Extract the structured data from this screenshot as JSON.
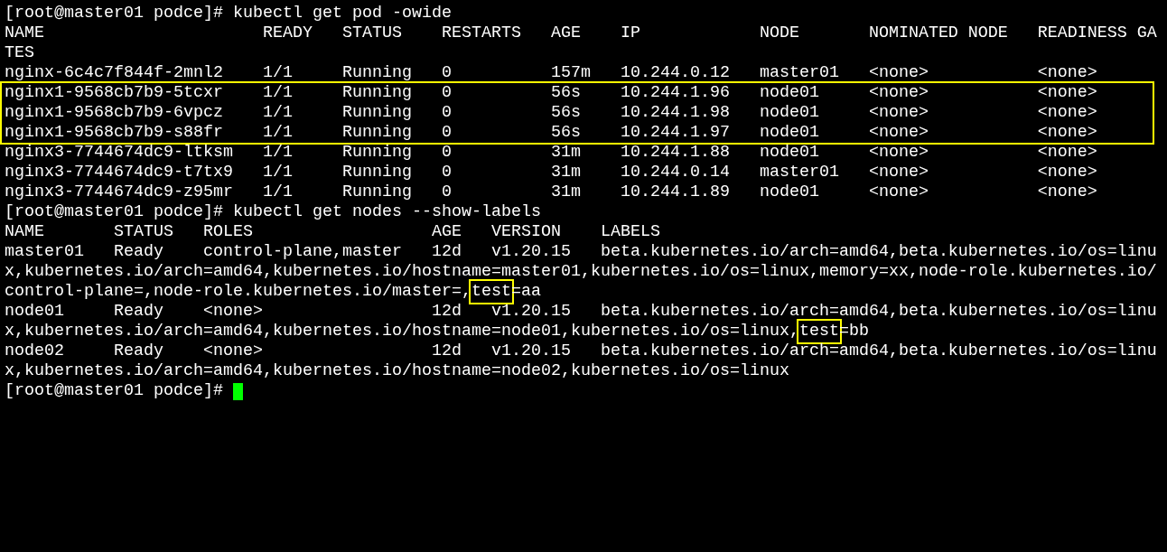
{
  "terminal": {
    "blocks": [
      {
        "kind": "line",
        "text": "[root@master01 podce]# kubectl get pod -owide"
      },
      {
        "kind": "line",
        "text": "NAME                      READY   STATUS    RESTARTS   AGE    IP            NODE       NOMINATED NODE   READINESS GA"
      },
      {
        "kind": "line",
        "text": "TES"
      },
      {
        "kind": "line",
        "text": "nginx-6c4c7f844f-2mnl2    1/1     Running   0          157m   10.244.0.12   master01   <none>           <none>"
      },
      {
        "kind": "group",
        "highlighted": true,
        "lines": [
          {
            "text": "nginx1-9568cb7b9-5tcxr    1/1     Running   0          56s    10.244.1.96   node01     <none>           <none>"
          },
          {
            "text": "nginx1-9568cb7b9-6vpcz    1/1     Running   0          56s    10.244.1.98   node01     <none>           <none>"
          },
          {
            "text": "nginx1-9568cb7b9-s88fr    1/1     Running   0          56s    10.244.1.97   node01     <none>           <none>"
          }
        ]
      },
      {
        "kind": "line",
        "text": "nginx3-7744674dc9-ltksm   1/1     Running   0          31m    10.244.1.88   node01     <none>           <none>"
      },
      {
        "kind": "line",
        "text": "nginx3-7744674dc9-t7tx9   1/1     Running   0          31m    10.244.0.14   master01   <none>           <none>"
      },
      {
        "kind": "line",
        "text": "nginx3-7744674dc9-z95mr   1/1     Running   0          31m    10.244.1.89   node01     <none>           <none>"
      },
      {
        "kind": "line",
        "text": "[root@master01 podce]# kubectl get nodes --show-labels"
      },
      {
        "kind": "line",
        "text": "NAME       STATUS   ROLES                  AGE   VERSION    LABELS"
      },
      {
        "kind": "line",
        "text": "master01   Ready    control-plane,master   12d   v1.20.15   beta.kubernetes.io/arch=amd64,beta.kubernetes.io/os=linu"
      },
      {
        "kind": "line",
        "text": "x,kubernetes.io/arch=amd64,kubernetes.io/hostname=master01,kubernetes.io/os=linux,memory=xx,node-role.kubernetes.io/"
      },
      {
        "kind": "line",
        "segments": [
          {
            "text": "control-plane=,node-role.kubernetes.io/master=,",
            "highlighted": false
          },
          {
            "text": "test",
            "highlighted": true
          },
          {
            "text": "=aa",
            "highlighted": false
          }
        ]
      },
      {
        "kind": "line",
        "text": "node01     Ready    <none>                 12d   v1.20.15   beta.kubernetes.io/arch=amd64,beta.kubernetes.io/os=linu"
      },
      {
        "kind": "line",
        "segments": [
          {
            "text": "x,kubernetes.io/arch=amd64,kubernetes.io/hostname=node01,kubernetes.io/os=linux,",
            "highlighted": false
          },
          {
            "text": "test",
            "highlighted": true
          },
          {
            "text": "=bb",
            "highlighted": false
          }
        ]
      },
      {
        "kind": "line",
        "text": "node02     Ready    <none>                 12d   v1.20.15   beta.kubernetes.io/arch=amd64,beta.kubernetes.io/os=linu"
      },
      {
        "kind": "line",
        "text": "x,kubernetes.io/arch=amd64,kubernetes.io/hostname=node02,kubernetes.io/os=linux"
      },
      {
        "kind": "prompt",
        "text": "[root@master01 podce]# ",
        "cursor": true
      }
    ]
  }
}
